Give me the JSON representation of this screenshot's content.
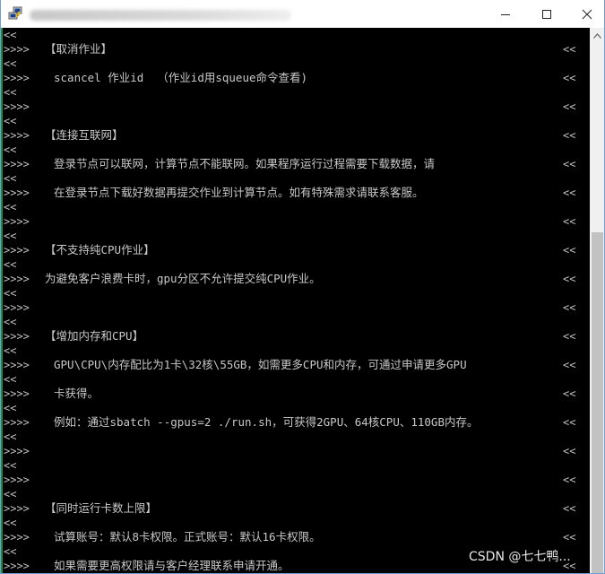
{
  "window": {
    "title_obscured": true,
    "controls": {
      "minimize": "minimize",
      "maximize": "maximize",
      "close": "close"
    }
  },
  "terminal": {
    "lines": [
      {
        "prefix": "<<",
        "content": "",
        "indent": false,
        "marker": ""
      },
      {
        "prefix": ">>>>",
        "content": "【取消作业】",
        "indent": false,
        "marker": "<<"
      },
      {
        "prefix": "<<",
        "content": "",
        "indent": false,
        "marker": ""
      },
      {
        "prefix": ">>>>",
        "content": "scancel 作业id  （作业id用squeue命令查看)",
        "indent": true,
        "marker": "<<"
      },
      {
        "prefix": "<<",
        "content": "",
        "indent": false,
        "marker": ""
      },
      {
        "prefix": ">>>>",
        "content": "",
        "indent": false,
        "marker": "<<"
      },
      {
        "prefix": "<<",
        "content": "",
        "indent": false,
        "marker": ""
      },
      {
        "prefix": ">>>>",
        "content": "【连接互联网】",
        "indent": false,
        "marker": "<<"
      },
      {
        "prefix": "<<",
        "content": "",
        "indent": false,
        "marker": ""
      },
      {
        "prefix": ">>>>",
        "content": "登录节点可以联网，计算节点不能联网。如果程序运行过程需要下载数据，请",
        "indent": true,
        "marker": "<<"
      },
      {
        "prefix": "<<",
        "content": "",
        "indent": false,
        "marker": ""
      },
      {
        "prefix": ">>>>",
        "content": "在登录节点下载好数据再提交作业到计算节点。如有特殊需求请联系客服。",
        "indent": true,
        "marker": "<<"
      },
      {
        "prefix": "<<",
        "content": "",
        "indent": false,
        "marker": ""
      },
      {
        "prefix": ">>>>",
        "content": "",
        "indent": false,
        "marker": "<<"
      },
      {
        "prefix": "<<",
        "content": "",
        "indent": false,
        "marker": ""
      },
      {
        "prefix": ">>>>",
        "content": "【不支持纯CPU作业】",
        "indent": false,
        "marker": "<<"
      },
      {
        "prefix": "<<",
        "content": "",
        "indent": false,
        "marker": ""
      },
      {
        "prefix": ">>>>",
        "content": "为避免客户浪费卡时，gpu分区不允许提交纯CPU作业。",
        "indent": false,
        "marker": "<<"
      },
      {
        "prefix": "<<",
        "content": "",
        "indent": false,
        "marker": ""
      },
      {
        "prefix": ">>>>",
        "content": "",
        "indent": false,
        "marker": "<<"
      },
      {
        "prefix": "<<",
        "content": "",
        "indent": false,
        "marker": ""
      },
      {
        "prefix": ">>>>",
        "content": "【增加内存和CPU】",
        "indent": false,
        "marker": "<<"
      },
      {
        "prefix": "<<",
        "content": "",
        "indent": false,
        "marker": ""
      },
      {
        "prefix": ">>>>",
        "content": "GPU\\CPU\\内存配比为1卡\\32核\\55GB，如需更多CPU和内存，可通过申请更多GPU",
        "indent": true,
        "marker": "<<"
      },
      {
        "prefix": "<<",
        "content": "",
        "indent": false,
        "marker": ""
      },
      {
        "prefix": ">>>>",
        "content": "卡获得。",
        "indent": true,
        "marker": "<<"
      },
      {
        "prefix": "<<",
        "content": "",
        "indent": false,
        "marker": ""
      },
      {
        "prefix": ">>>>",
        "content": "例如：通过sbatch --gpus=2 ./run.sh，可获得2GPU、64核CPU、110GB内存。",
        "indent": true,
        "marker": "<<"
      },
      {
        "prefix": "<<",
        "content": "",
        "indent": false,
        "marker": ""
      },
      {
        "prefix": ">>>>",
        "content": "",
        "indent": false,
        "marker": "<<"
      },
      {
        "prefix": "<<",
        "content": "",
        "indent": false,
        "marker": ""
      },
      {
        "prefix": ">>>>",
        "content": "",
        "indent": false,
        "marker": "<<"
      },
      {
        "prefix": "<<",
        "content": "",
        "indent": false,
        "marker": ""
      },
      {
        "prefix": ">>>>",
        "content": "【同时运行卡数上限】",
        "indent": false,
        "marker": "<<"
      },
      {
        "prefix": "<<",
        "content": "",
        "indent": false,
        "marker": ""
      },
      {
        "prefix": ">>>>",
        "content": "试算账号：默认8卡权限。正式账号：默认16卡权限。",
        "indent": true,
        "marker": "<<"
      },
      {
        "prefix": "<<",
        "content": "",
        "indent": false,
        "marker": ""
      },
      {
        "prefix": ">>>>",
        "content": "如果需要更高权限请与客户经理联系申请开通。",
        "indent": true,
        "marker": "<<"
      }
    ]
  },
  "watermark": "CSDN @七七鸭..."
}
